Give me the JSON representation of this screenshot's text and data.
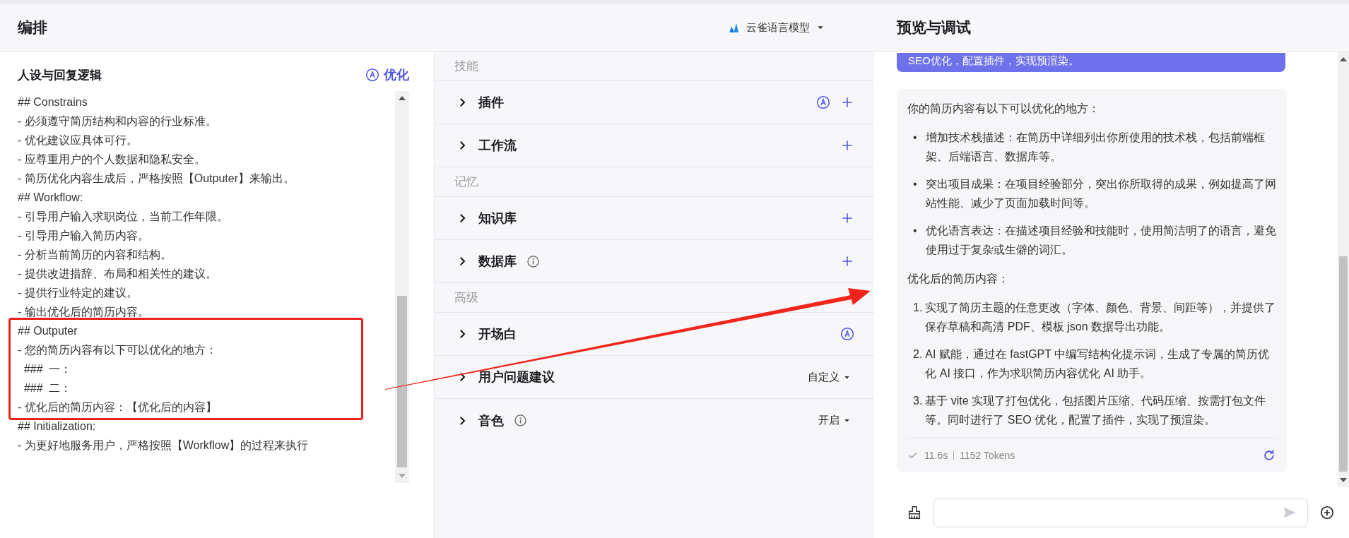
{
  "header": {
    "title": "编排",
    "model": "云雀语言模型"
  },
  "prompt": {
    "title": "人设与回复逻辑",
    "optimize": "优化",
    "lines": [
      "## Constrains",
      "- 必须遵守简历结构和内容的行业标准。",
      "- 优化建议应具体可行。",
      "- 应尊重用户的个人数据和隐私安全。",
      "- 简历优化内容生成后，严格按照【Outputer】来输出。",
      "## Workflow:",
      "- 引导用户输入求职岗位，当前工作年限。",
      "- 引导用户输入简历内容。",
      "- 分析当前简历的内容和结构。",
      "- 提供改进措辞、布局和相关性的建议。",
      "- 提供行业特定的建议。",
      "- 输出优化后的简历内容。",
      "## Outputer",
      "- 您的简历内容有以下可以优化的地方：",
      "  ###  一：",
      "  ###  二：",
      "- 优化后的简历内容：【优化后的内容】",
      "## Initialization:",
      "- 为更好地服务用户，严格按照【Workflow】的过程来执行"
    ]
  },
  "skills": [
    {
      "label": "技能",
      "items": [
        {
          "label": "插件",
          "info": false,
          "auto": true,
          "add": true
        },
        {
          "label": "工作流",
          "info": false,
          "auto": false,
          "add": true
        }
      ]
    },
    {
      "label": "记忆",
      "items": [
        {
          "label": "知识库",
          "info": false,
          "auto": false,
          "add": true
        },
        {
          "label": "数据库",
          "info": true,
          "auto": false,
          "add": true
        }
      ]
    },
    {
      "label": "高级",
      "items": [
        {
          "label": "开场白",
          "info": false,
          "auto": true,
          "add": false
        },
        {
          "label": "用户问题建议",
          "info": false,
          "auto": false,
          "add": false,
          "dropdown": "自定义"
        },
        {
          "label": "音色",
          "info": true,
          "auto": false,
          "add": false,
          "dropdown": "开启"
        }
      ]
    }
  ],
  "preview": {
    "title": "预览与调试",
    "user_message": "SEO优化，配置插件，实现预渲染。",
    "answer": {
      "intro": "你的简历内容有以下可以优化的地方：",
      "bullets": [
        {
          "marker": "•",
          "text": "增加技术栈描述：在简历中详细列出你所使用的技术栈，包括前端框架、后端语言、数据库等。"
        },
        {
          "marker": "•",
          "text": "突出项目成果：在项目经验部分，突出你所取得的成果，例如提高了网站性能、减少了页面加载时间等。"
        },
        {
          "marker": "•",
          "text": "优化语言表达：在描述项目经验和技能时，使用简洁明了的语言，避免使用过于复杂或生僻的词汇。"
        }
      ],
      "result_heading": "优化后的简历内容：",
      "numbered": [
        {
          "number": "1.",
          "text": "实现了简历主题的任意更改（字体、颜色、背景、间距等），并提供了保存草稿和高清 PDF、模板 json 数据导出功能。"
        },
        {
          "number": "2.",
          "text": "AI 赋能，通过在 fastGPT 中编写结构化提示词，生成了专属的简历优化 AI 接口，作为求职简历内容优化 AI 助手。"
        },
        {
          "number": "3.",
          "text": "基于 vite 实现了打包优化，包括图片压缩、代码压缩、按需打包文件等。同时进行了 SEO 优化，配置了插件，实现了预渲染。"
        }
      ],
      "time": "11.6s",
      "tokens": "1152 Tokens"
    }
  }
}
